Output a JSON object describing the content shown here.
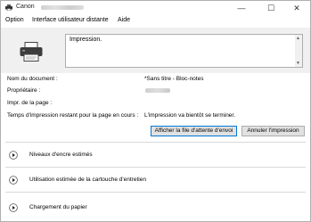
{
  "window": {
    "title": "Canon",
    "controls": {
      "minimize": "—",
      "maximize": "☐",
      "close": "✕"
    }
  },
  "menu": {
    "items": [
      "Option",
      "Interface utilisateur distante",
      "Aide"
    ]
  },
  "status": {
    "message": "Impression."
  },
  "info": {
    "document_label": "Nom du document :",
    "document_value": "*Sans titre - Bloc-notes",
    "owner_label": "Propriétaire :",
    "printing_page_label": "Impr. de la page :",
    "time_remaining_label": "Temps d'impression restant pour la page en cours :",
    "time_remaining_value": "L'impression va bientôt se terminer."
  },
  "buttons": {
    "show_queue": "Afficher la file d'attente d'envoi",
    "cancel_print": "Annuler l'impression"
  },
  "sections": [
    {
      "label": "Niveaux d'encre estimés"
    },
    {
      "label": "Utilisation estimée de la cartouche d'entretien"
    },
    {
      "label": "Chargement du papier"
    }
  ],
  "icons": {
    "app": "printer-app-icon",
    "printer": "printer-icon",
    "expand": "play-circle-icon"
  }
}
